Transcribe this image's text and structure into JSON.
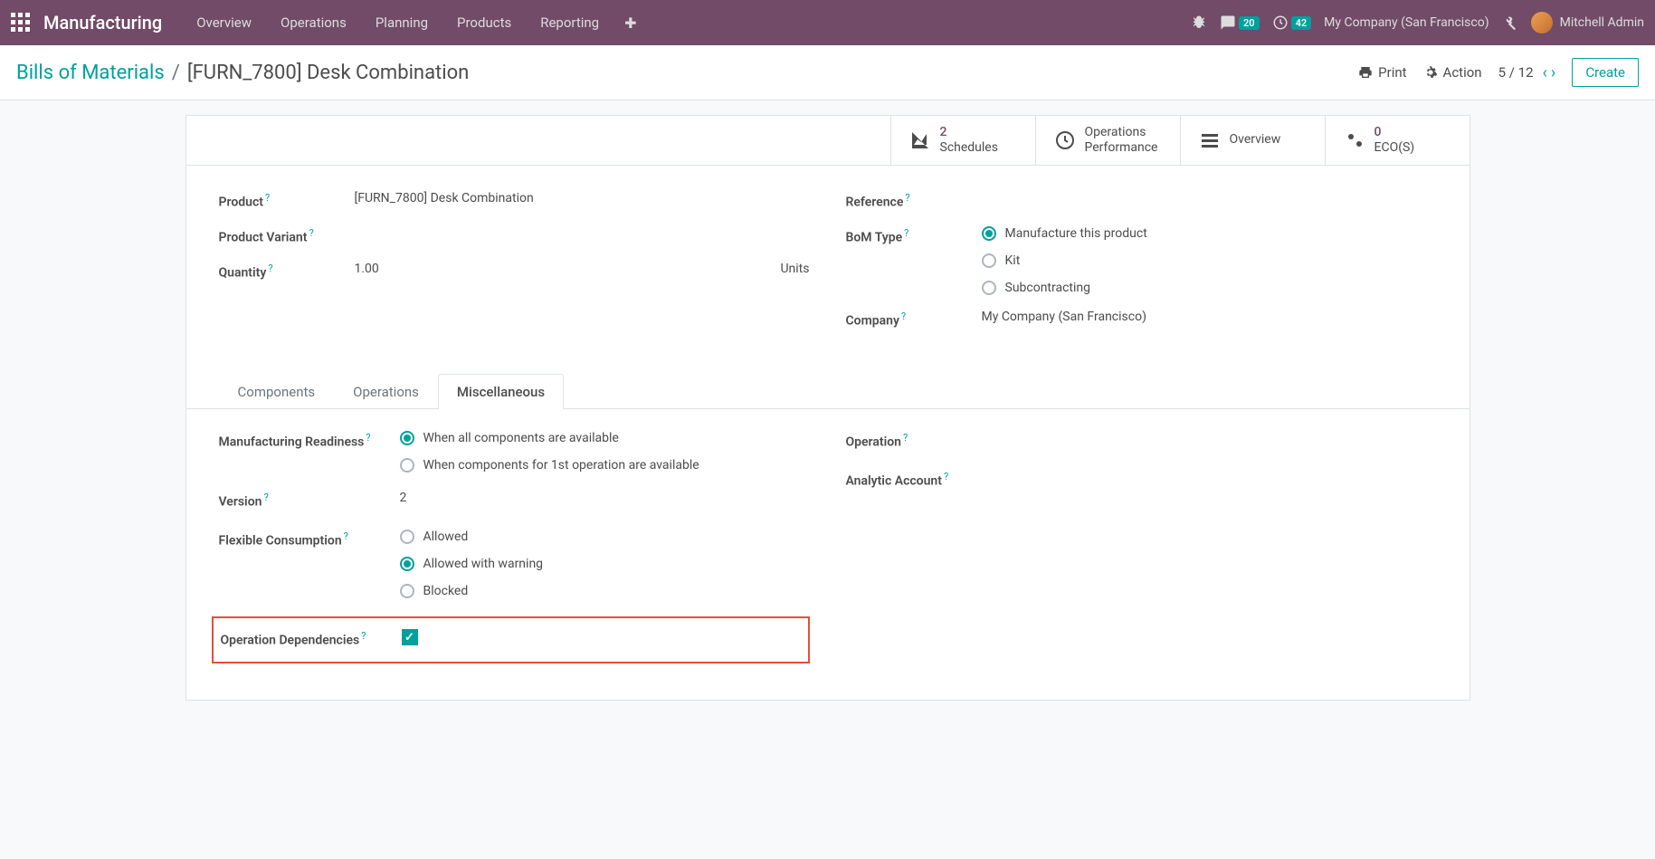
{
  "navbar": {
    "brand": "Manufacturing",
    "menu": [
      "Overview",
      "Operations",
      "Planning",
      "Products",
      "Reporting"
    ],
    "messages_badge": "20",
    "activities_badge": "42",
    "company": "My Company (San Francisco)",
    "user": "Mitchell Admin"
  },
  "control": {
    "back_label": "Bills of Materials",
    "current": "[FURN_7800] Desk Combination",
    "print": "Print",
    "action": "Action",
    "pager": "5 / 12",
    "create": "Create"
  },
  "statbtns": {
    "schedules_num": "2",
    "schedules_label": "Schedules",
    "ops_perf_l1": "Operations",
    "ops_perf_l2": "Performance",
    "overview": "Overview",
    "eco_num": "0",
    "eco_label": "ECO(S)"
  },
  "form": {
    "product_label": "Product",
    "product_value": "[FURN_7800] Desk Combination",
    "variant_label": "Product Variant",
    "quantity_label": "Quantity",
    "quantity_value": "1.00",
    "quantity_uom": "Units",
    "reference_label": "Reference",
    "bom_type_label": "BoM Type",
    "bom_opt1": "Manufacture this product",
    "bom_opt2": "Kit",
    "bom_opt3": "Subcontracting",
    "company_label": "Company",
    "company_value": "My Company (San Francisco)"
  },
  "tabs": {
    "components": "Components",
    "operations": "Operations",
    "misc": "Miscellaneous"
  },
  "misc": {
    "readiness_label": "Manufacturing Readiness",
    "readiness_opt1": "When all components are available",
    "readiness_opt2": "When components for 1st operation are available",
    "version_label": "Version",
    "version_value": "2",
    "flex_label": "Flexible Consumption",
    "flex_opt1": "Allowed",
    "flex_opt2": "Allowed with warning",
    "flex_opt3": "Blocked",
    "opdep_label": "Operation Dependencies",
    "operation_label": "Operation",
    "analytic_label": "Analytic Account"
  }
}
